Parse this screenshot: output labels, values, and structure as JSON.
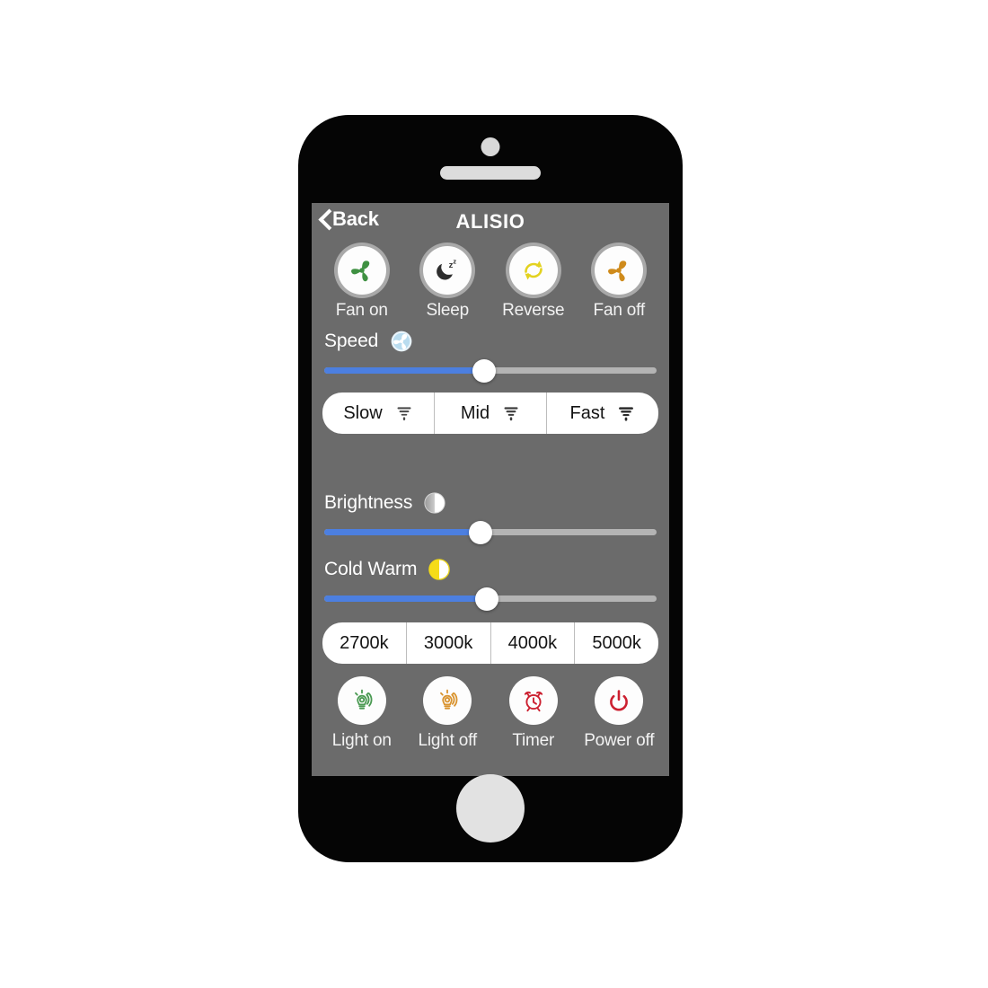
{
  "device": {
    "frame": "smartphone",
    "camera": "front-camera",
    "speaker": "earpiece-speaker",
    "home_button": "home-button"
  },
  "header": {
    "back_label": "Back",
    "back_icon": "chevron-left-icon",
    "title": "ALISIO"
  },
  "fan_controls": [
    {
      "label": "Fan on",
      "icon": "fan-icon",
      "color": "#3f9142"
    },
    {
      "label": "Sleep",
      "icon": "moon-zzz-icon",
      "color": "#3a3a3a"
    },
    {
      "label": "Reverse",
      "icon": "reverse-loop-icon",
      "color": "#e3d21f"
    },
    {
      "label": "Fan off",
      "icon": "fan-icon",
      "color": "#cf8b1c"
    }
  ],
  "speed": {
    "label": "Speed",
    "icon": "fan-glow-icon",
    "slider": {
      "name": "speed-slider",
      "value": 48,
      "min": 0,
      "max": 100,
      "fill_color": "#4c7fe0",
      "rail_color": "#b4b4b4"
    },
    "presets": [
      {
        "label": "Slow",
        "icon": "tornado-small-icon"
      },
      {
        "label": "Mid",
        "icon": "tornado-medium-icon"
      },
      {
        "label": "Fast",
        "icon": "tornado-large-icon"
      }
    ]
  },
  "brightness": {
    "label": "Brightness",
    "icon": "half-circle-white-icon",
    "slider": {
      "name": "brightness-slider",
      "value": 47,
      "min": 0,
      "max": 100,
      "fill_color": "#4c7fe0",
      "rail_color": "#b4b4b4"
    }
  },
  "cold_warm": {
    "label": "Cold Warm",
    "icon": "half-circle-yellow-icon",
    "icon_color": "#f5dc18",
    "slider": {
      "name": "cold-warm-slider",
      "value": 49,
      "min": 0,
      "max": 100,
      "fill_color": "#4c7fe0",
      "rail_color": "#b4b4b4"
    }
  },
  "color_temperatures": [
    {
      "label": "2700k"
    },
    {
      "label": "3000k"
    },
    {
      "label": "4000k"
    },
    {
      "label": "5000k"
    }
  ],
  "power_controls": [
    {
      "label": "Light on",
      "icon": "light-bulb-icon",
      "color": "#4a9a52"
    },
    {
      "label": "Light off",
      "icon": "light-bulb-icon",
      "color": "#d9932e"
    },
    {
      "label": "Timer",
      "icon": "alarm-clock-icon",
      "color": "#cc2030"
    },
    {
      "label": "Power off",
      "icon": "power-icon",
      "color": "#cc2030"
    }
  ],
  "theme": {
    "screen_background": "#6b6b6b",
    "frame_color": "#050505",
    "text_color": "#ffffff",
    "pill_background": "#ffffff"
  }
}
